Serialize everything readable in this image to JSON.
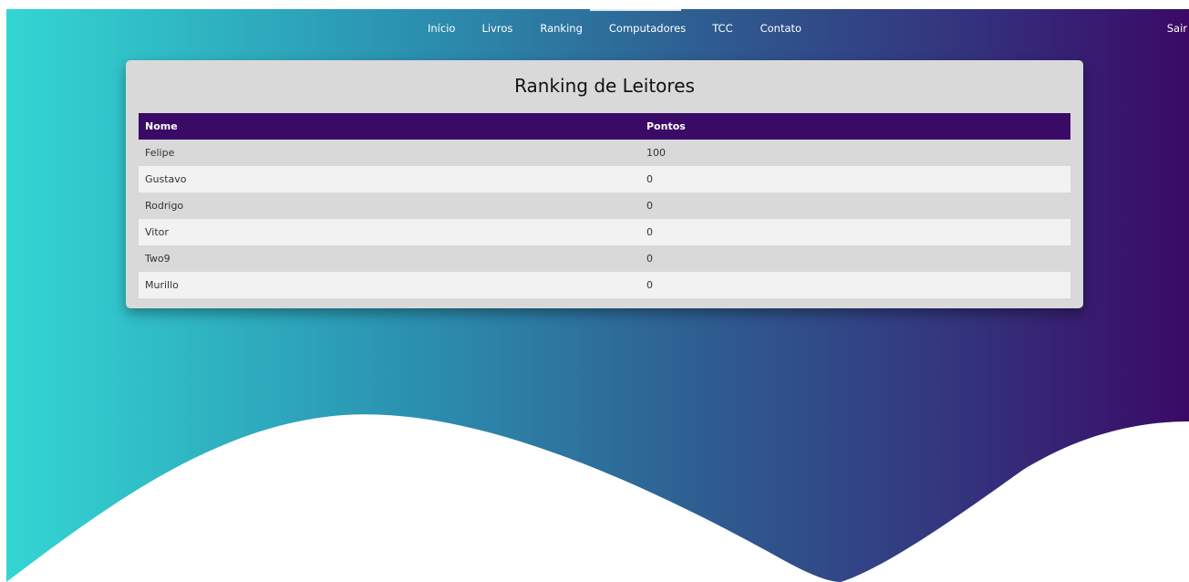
{
  "nav": {
    "links": [
      {
        "label": "Início"
      },
      {
        "label": "Livros"
      },
      {
        "label": "Ranking"
      },
      {
        "label": "Computadores"
      },
      {
        "label": "TCC"
      },
      {
        "label": "Contato"
      }
    ],
    "logout_label": "Sair"
  },
  "ranking": {
    "title": "Ranking de Leitores",
    "columns": [
      "Nome",
      "Pontos"
    ],
    "rows": [
      {
        "name": "Felipe",
        "points": "100"
      },
      {
        "name": "Gustavo",
        "points": "0"
      },
      {
        "name": "Rodrigo",
        "points": "0"
      },
      {
        "name": "Vitor",
        "points": "0"
      },
      {
        "name": "Two9",
        "points": "0"
      },
      {
        "name": "Murillo",
        "points": "0"
      }
    ]
  },
  "colors": {
    "gradient_start": "#33d6d3",
    "gradient_end": "#3a0a66",
    "table_header": "#3a0a66",
    "card_background": "#d9d9d9",
    "row_alternate": "#f2f2f2"
  }
}
